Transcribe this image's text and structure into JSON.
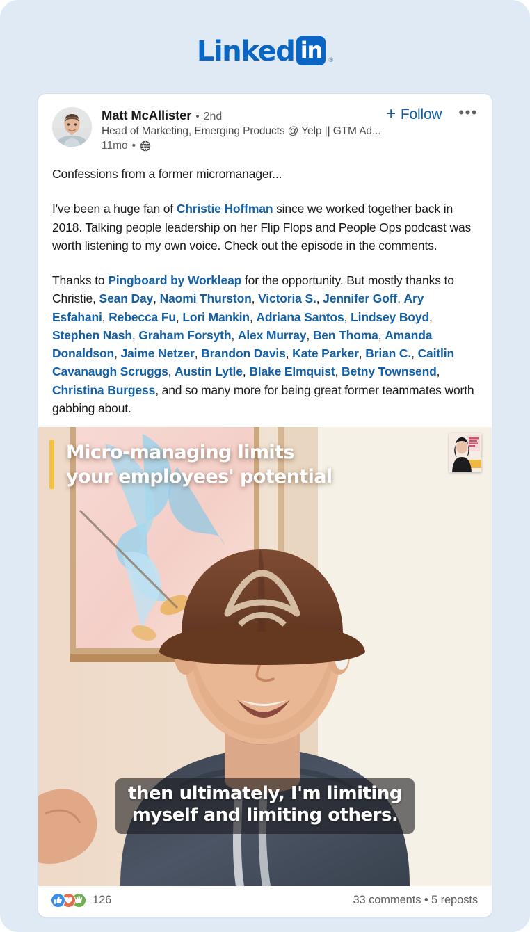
{
  "brand": {
    "word": "Linked",
    "badge": "in",
    "registered": "®"
  },
  "post": {
    "author": {
      "name": "Matt McAllister",
      "separator": "•",
      "degree": "2nd",
      "headline": "Head of Marketing, Emerging Products @ Yelp || GTM Ad...",
      "time": "11mo",
      "meta_separator": "•",
      "visibility_icon": "globe-icon",
      "avatar_icon": "user-avatar"
    },
    "actions": {
      "follow_plus": "+",
      "follow_label": "Follow",
      "more_label": "•••"
    },
    "body": {
      "paragraph_1": "Confessions from a former micromanager...",
      "p2_part_1": "I've been a huge fan of ",
      "p2_link_1": "Christie Hoffman",
      "p2_part_2": " since we worked together back in 2018. Talking people leadership on her Flip Flops and People Ops podcast was worth listening to my own voice. Check out the episode in the comments.",
      "p3_part_1": "Thanks to ",
      "p3_link_1": "Pingboard by Workleap",
      "p3_part_2": " for the opportunity. But mostly thanks to Christie, ",
      "p3_names": [
        "Sean Day",
        "Naomi Thurston",
        "Victoria S.",
        "Jennifer Goff",
        "Ary Esfahani",
        "Rebecca Fu",
        "Lori Mankin",
        "Adriana Santos",
        "Lindsey Boyd",
        "Stephen Nash",
        "Graham Forsyth",
        "Alex Murray",
        "Ben Thoma",
        "Amanda Donaldson",
        "Jaime Netzer",
        "Brandon Davis",
        "Kate Parker",
        "Brian C.",
        "Caitlin Cavanaugh Scruggs",
        "Austin Lytle",
        "Blake Elmquist",
        "Betny Townsend",
        "Christina Burgess"
      ],
      "p3_part_3": ", and so many more for being great former teammates worth gabbing about."
    },
    "media": {
      "overlay_line_1": "Micro-managing limits",
      "overlay_line_2": "your employees' potential",
      "caption_line_1": "then ultimately, I'm limiting",
      "caption_line_2": "myself and limiting others.",
      "thumbnail_name": "podcast-thumbnail",
      "accent_bar_color": "#f2c246"
    },
    "engagement": {
      "reaction_icons": [
        "like-icon",
        "love-icon",
        "support-icon"
      ],
      "reaction_count": "126",
      "comments_reposts": "33 comments • 5 reposts"
    }
  },
  "colors": {
    "page_background": "#dfeaf5",
    "card_background": "#ffffff",
    "brand_blue": "#0a66c2",
    "link_blue": "#1461a8",
    "text_primary": "#1a1a1a",
    "text_secondary": "#5f5f5f",
    "reaction_like": "#378fe9",
    "reaction_love": "#df704d",
    "reaction_support": "#6dae4f"
  }
}
